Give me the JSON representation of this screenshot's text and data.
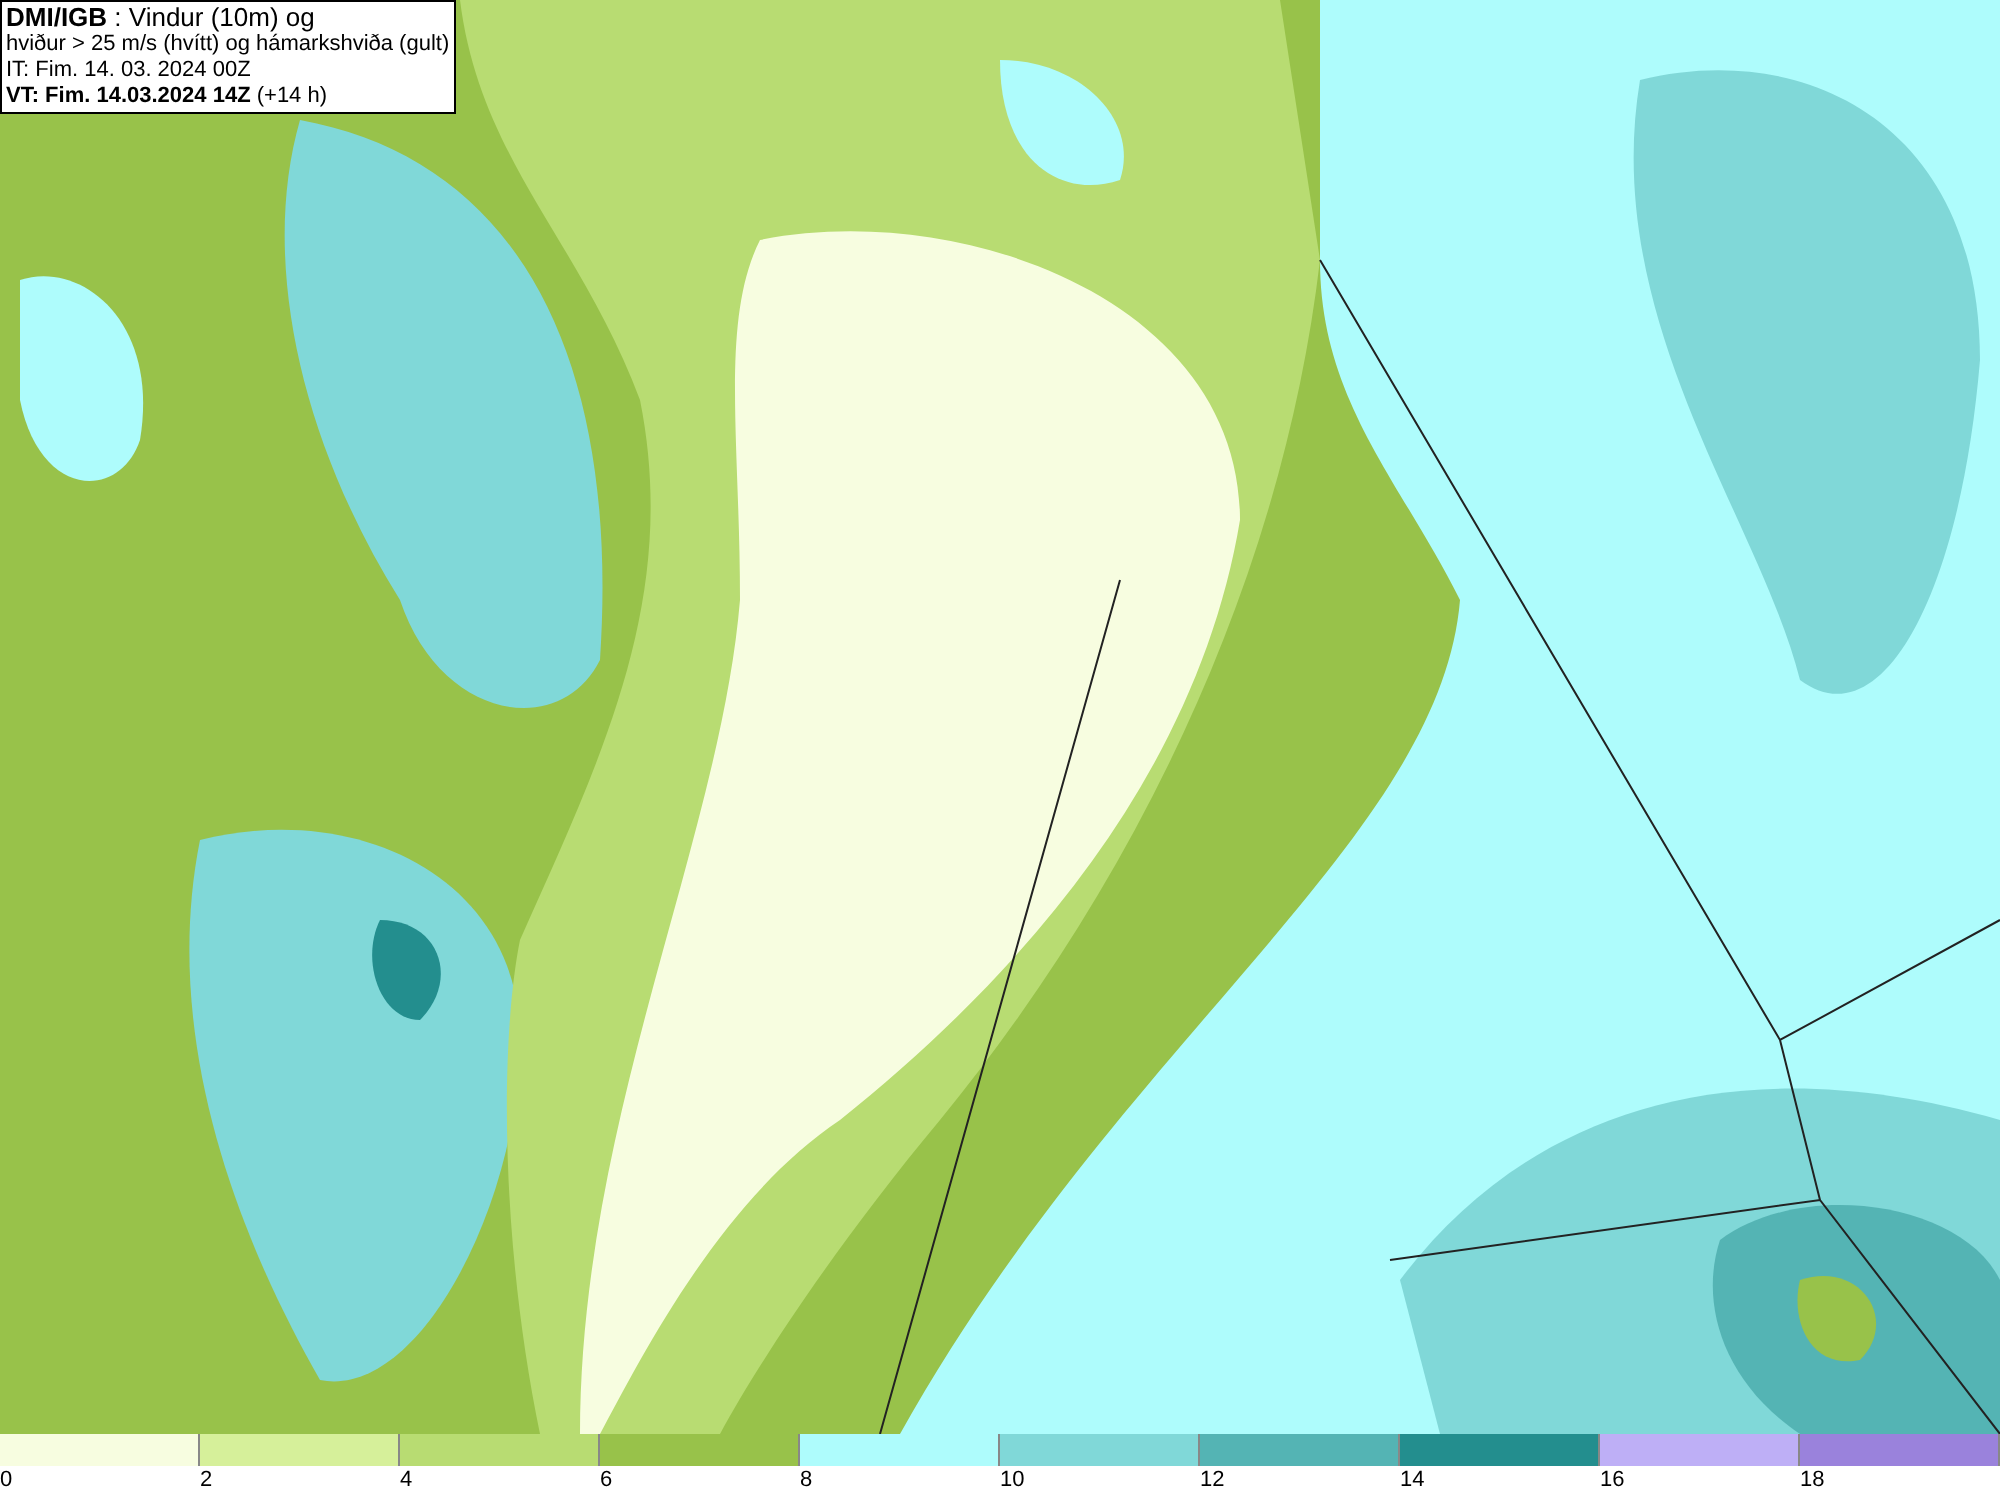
{
  "info_box": {
    "lines": [
      "**DMI/IGB** : Vindur (10m) og",
      "hviður > 25 m/s (hvítt) og hámarkshviða (gult)",
      "IT: Fim. 14. 03. 2024 00Z",
      "**VT: Fim. 14.03.2024 14Z** (+14 h)"
    ]
  },
  "legend": {
    "segments": [
      {
        "color": "#f7fde0"
      },
      {
        "color": "#d6f09a"
      },
      {
        "color": "#b8dc72"
      },
      {
        "color": "#98c24a"
      },
      {
        "color": "#aefcfc"
      },
      {
        "color": "#80d8d8"
      },
      {
        "color": "#54b4b4"
      },
      {
        "color": "#238e8e"
      },
      {
        "color": "#beaff6"
      },
      {
        "color": "#9a82dc"
      }
    ],
    "ticks": [
      "0",
      "2",
      "4",
      "6",
      "8",
      "10",
      "12",
      "14",
      "16",
      "18"
    ]
  }
}
